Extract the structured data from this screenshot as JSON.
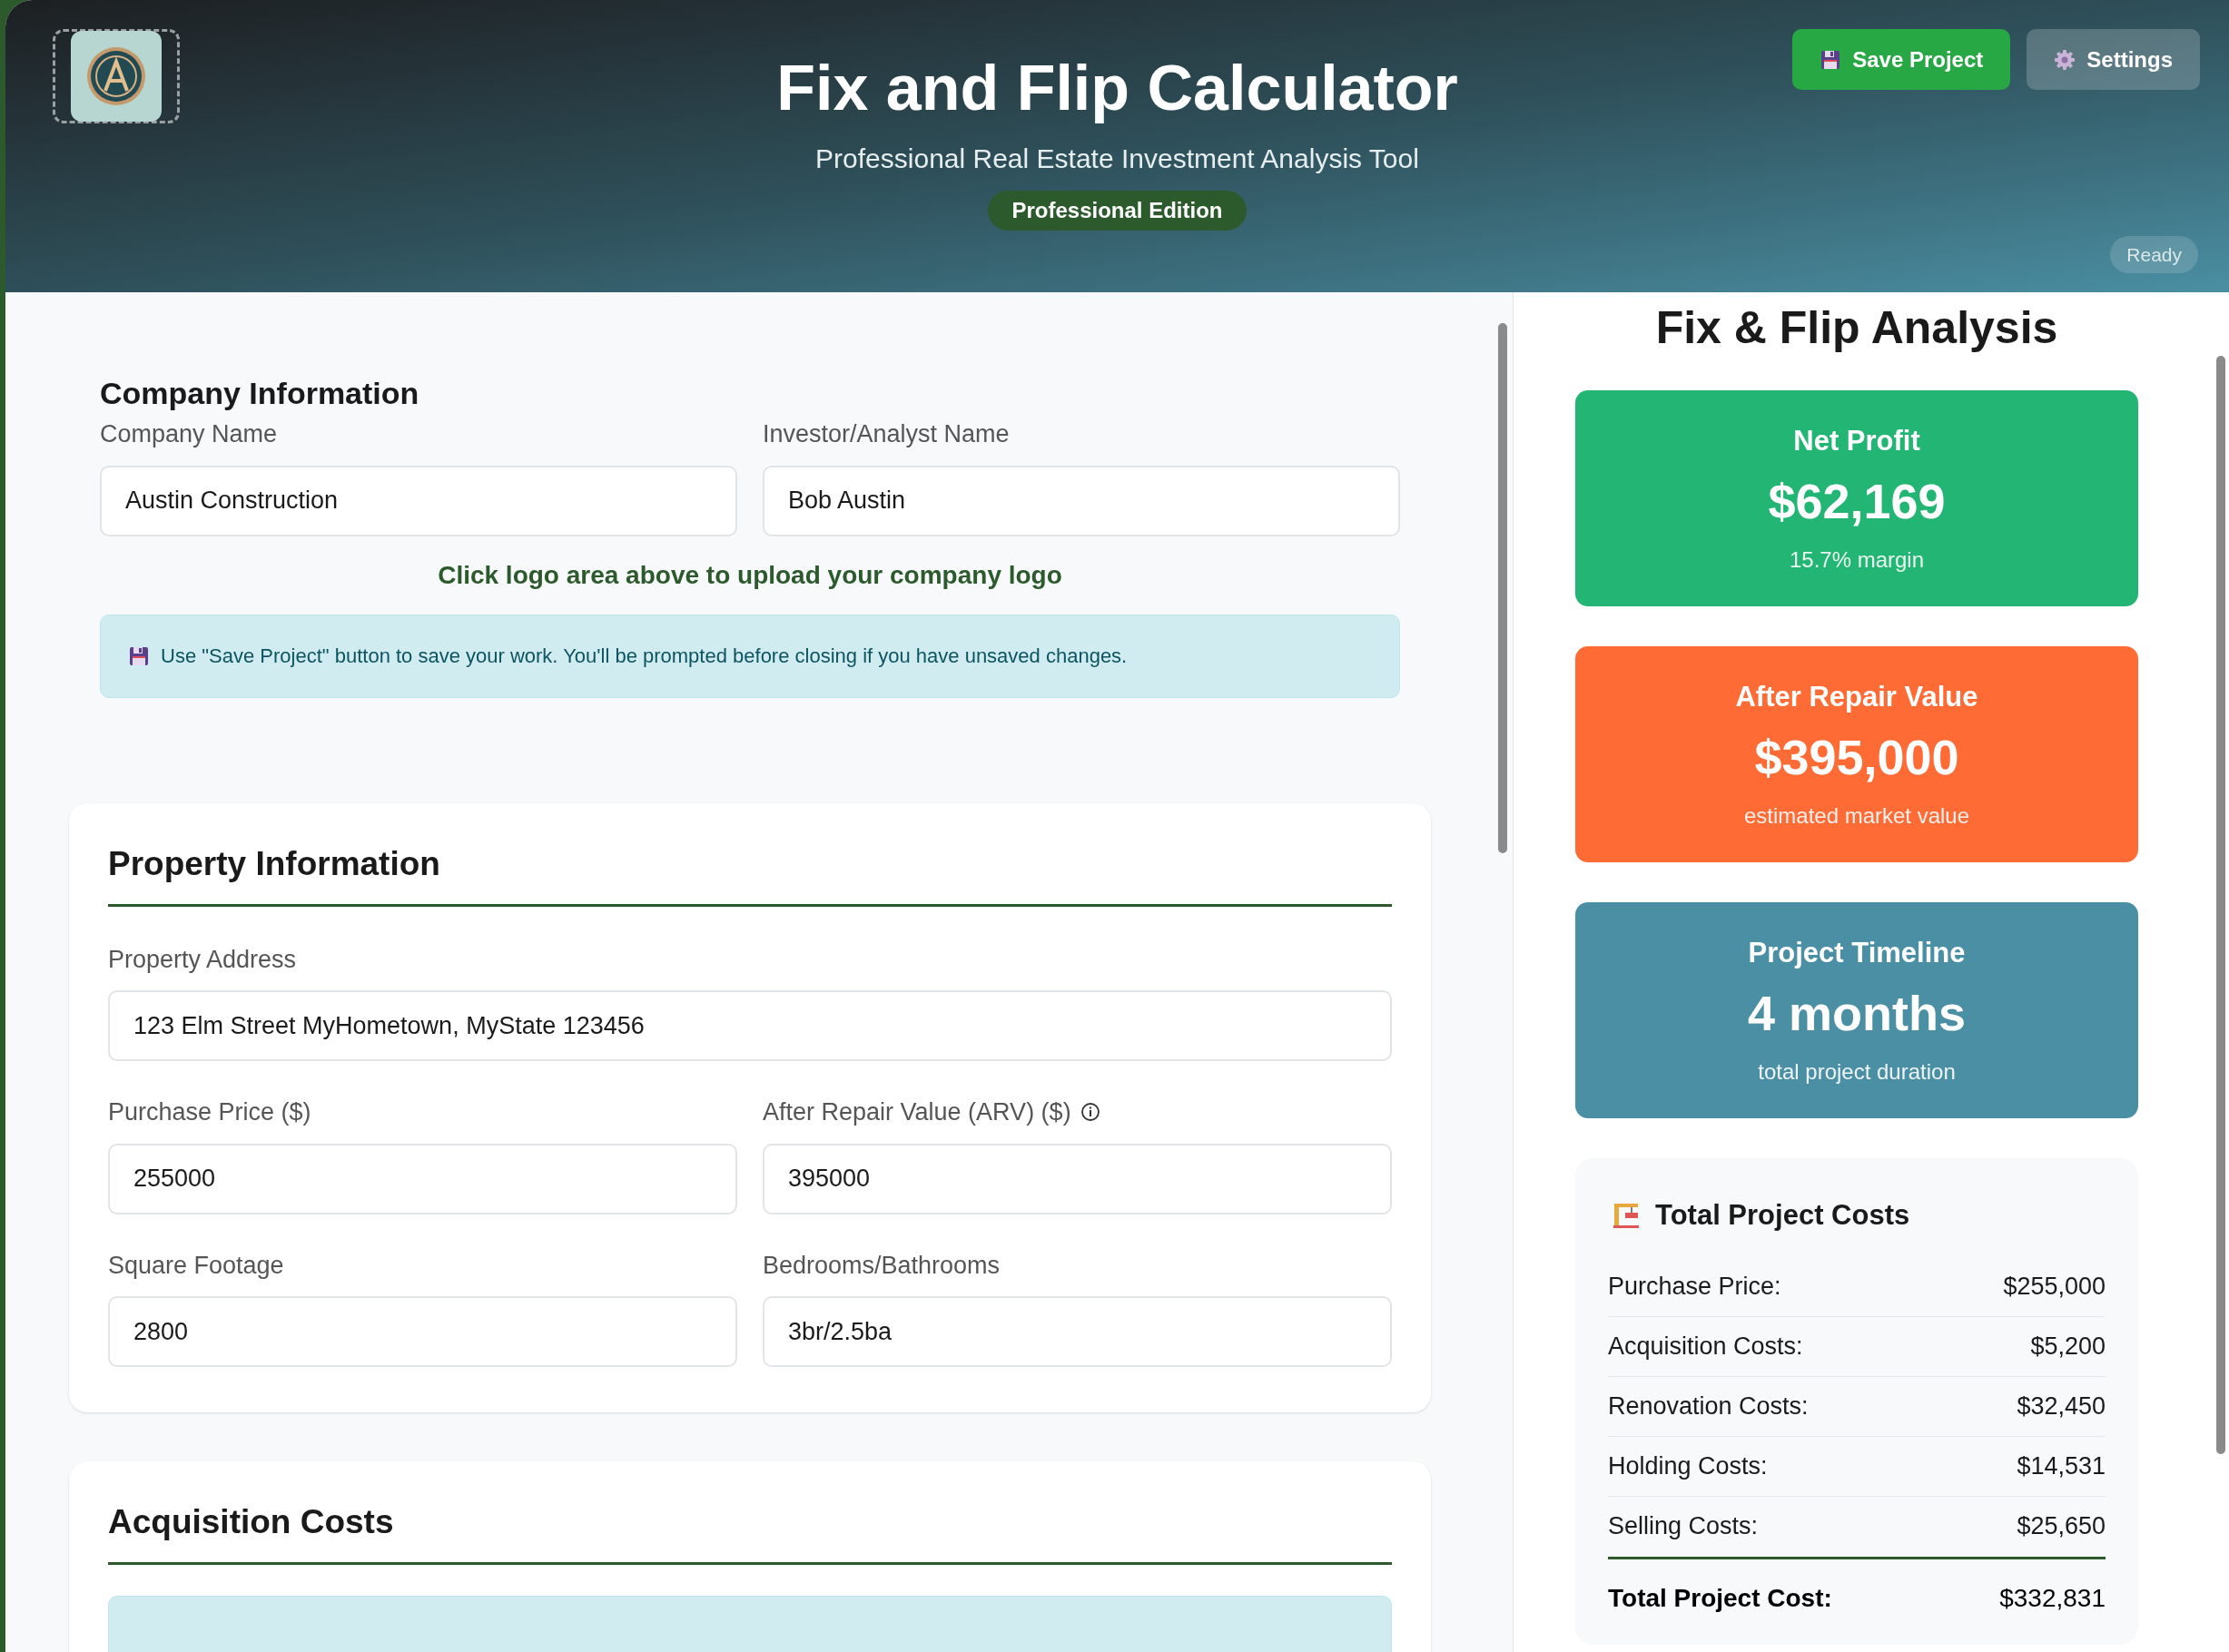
{
  "header": {
    "title": "Fix and Flip Calculator",
    "subtitle": "Professional Real Estate Investment Analysis Tool",
    "edition_badge": "Professional Edition",
    "buttons": [
      {
        "label": "Save Project",
        "kind": "save"
      },
      {
        "label": "Settings",
        "kind": "settings"
      }
    ],
    "status": "Ready"
  },
  "company_section": {
    "heading": "Company Information",
    "fields": [
      {
        "label": "Company Name",
        "value": "Austin Construction"
      },
      {
        "label": "Investor/Analyst Name",
        "value": "Bob Austin"
      }
    ],
    "logo_hint": "Click logo area above to upload your company logo",
    "notice": "Use \"Save Project\" button to save your work. You'll be prompted before closing if you have unsaved changes."
  },
  "property_section": {
    "heading": "Property Information",
    "rows": [
      {
        "fields": [
          {
            "label": "Property Address",
            "value": "123 Elm Street MyHometown, MyState 123456",
            "info": false
          }
        ]
      },
      {
        "fields": [
          {
            "label": "Purchase Price ($)",
            "value": "255000",
            "info": false
          },
          {
            "label": "After Repair Value (ARV) ($)",
            "value": "395000",
            "info": true
          }
        ]
      },
      {
        "fields": [
          {
            "label": "Square Footage",
            "value": "2800",
            "info": false
          },
          {
            "label": "Bedrooms/Bathrooms",
            "value": "3br/2.5ba",
            "info": false
          }
        ]
      }
    ]
  },
  "acquisition_section": {
    "heading": "Acquisition Costs"
  },
  "analysis": {
    "title": "Fix & Flip Analysis",
    "metrics": [
      {
        "label": "Net Profit",
        "value": "$62,169",
        "caption": "15.7% margin",
        "color": "#22b573"
      },
      {
        "label": "After Repair Value",
        "value": "$395,000",
        "caption": "estimated market value",
        "color": "#ff6b35"
      },
      {
        "label": "Project Timeline",
        "value": "4 months",
        "caption": "total project duration",
        "color": "#4a8fa3"
      }
    ],
    "costs": {
      "heading": "Total Project Costs",
      "rows": [
        {
          "label": "Purchase Price:",
          "value": "$255,000"
        },
        {
          "label": "Acquisition Costs:",
          "value": "$5,200"
        },
        {
          "label": "Renovation Costs:",
          "value": "$32,450"
        },
        {
          "label": "Holding Costs:",
          "value": "$14,531"
        },
        {
          "label": "Selling Costs:",
          "value": "$25,650"
        }
      ],
      "total": {
        "label": "Total Project Cost:",
        "value": "$332,831"
      }
    }
  }
}
